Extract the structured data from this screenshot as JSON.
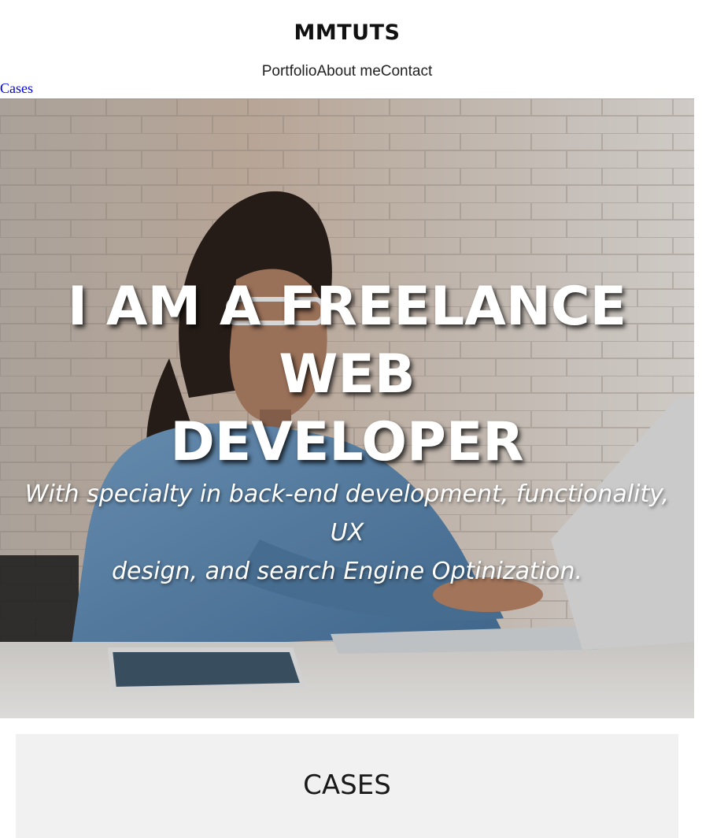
{
  "header": {
    "brand": "MMTUTS",
    "nav": [
      {
        "label": "Portfolio"
      },
      {
        "label": "About me"
      },
      {
        "label": "Contact"
      }
    ]
  },
  "skip_link": "Cases",
  "hero": {
    "title_lines": [
      "I AM A FREELANCE",
      "WEB",
      "DEVELOPER"
    ],
    "subtitle_lines": [
      "With specialty in back-end development, functionality, UX",
      "design, and search Engine Optinization."
    ]
  },
  "cases": {
    "heading": "CASES",
    "background": "#f1f1f1"
  },
  "colors": {
    "link": "#0000ee",
    "hero_text": "#ffffff"
  }
}
